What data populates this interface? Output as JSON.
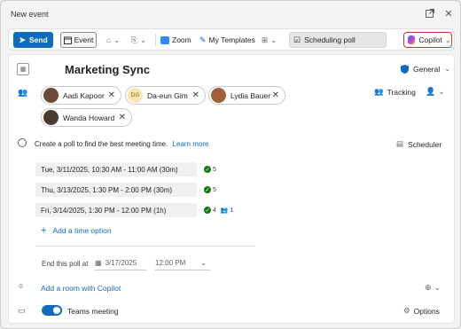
{
  "window": {
    "title": "New event"
  },
  "toolbar": {
    "send_label": "Send",
    "event_label": "Event",
    "zoom_label": "Zoom",
    "templates_label": "My Templates",
    "scheduling_poll_label": "Scheduling poll",
    "copilot_label": "Copilot"
  },
  "event": {
    "subject": "Marketing Sync",
    "sensitivity": "General",
    "tracking_label": "Tracking"
  },
  "attendees": [
    {
      "name": "Aadi Kapoor",
      "initials": ""
    },
    {
      "name": "Da-eun Gim",
      "initials": "DG"
    },
    {
      "name": "Lydia Bauer",
      "initials": ""
    },
    {
      "name": "Wanda Howard",
      "initials": ""
    }
  ],
  "poll": {
    "prompt": "Create a poll to find the best meeting time.",
    "learn_more": "Learn more",
    "scheduler_label": "Scheduler",
    "options": [
      {
        "label": "Tue, 3/11/2025, 10:30 AM - 11:00 AM (30m)",
        "yes": "5",
        "maybe": ""
      },
      {
        "label": "Thu, 3/13/2025, 1:30 PM - 2:00 PM (30m)",
        "yes": "5",
        "maybe": ""
      },
      {
        "label": "Fri, 3/14/2025, 1:30 PM - 12:00 PM (1h)",
        "yes": "4",
        "maybe": "1"
      }
    ],
    "add_time_label": "Add a time option",
    "end_label": "End this poll at",
    "end_date": "3/17/2025",
    "end_time": "12:00 PM"
  },
  "location": {
    "add_room_label": "Add a room with Copilot"
  },
  "teams": {
    "label": "Teams meeting",
    "enabled": true,
    "options_label": "Options"
  },
  "colors": {
    "accent": "#0f6cbd",
    "copilot_border": "#d13438",
    "check": "#107c10"
  }
}
